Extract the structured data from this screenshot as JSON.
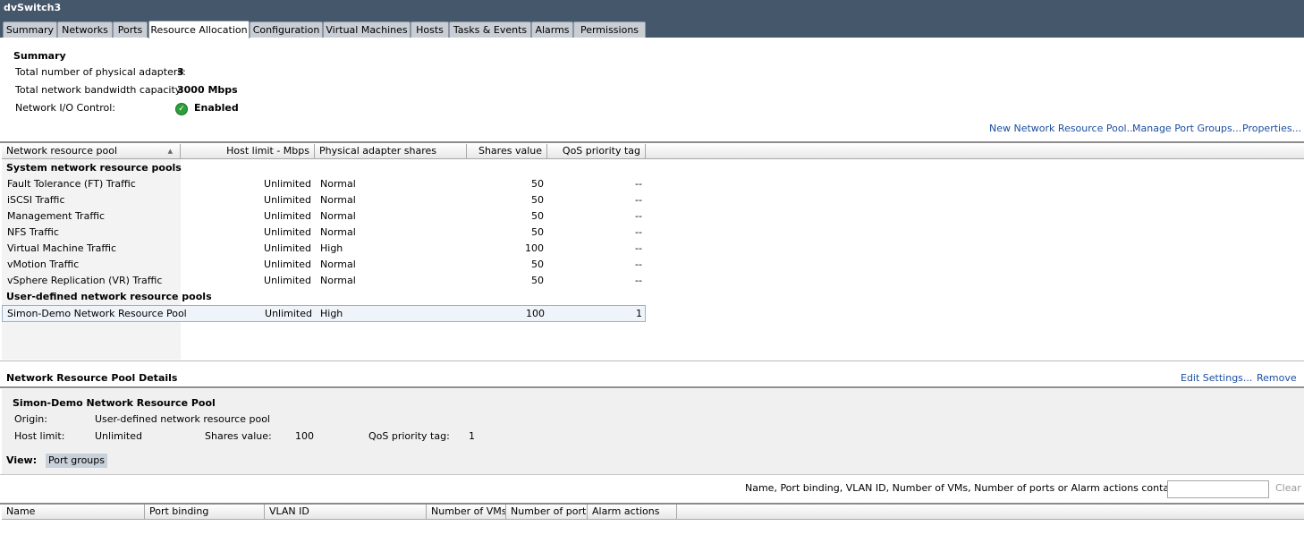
{
  "window": {
    "title": "dvSwitch3"
  },
  "tabs": [
    {
      "label": "Summary"
    },
    {
      "label": "Networks"
    },
    {
      "label": "Ports"
    },
    {
      "label": "Resource Allocation"
    },
    {
      "label": "Configuration"
    },
    {
      "label": "Virtual Machines"
    },
    {
      "label": "Hosts"
    },
    {
      "label": "Tasks & Events"
    },
    {
      "label": "Alarms"
    },
    {
      "label": "Permissions"
    }
  ],
  "active_tab": "Resource Allocation",
  "summary": {
    "heading": "Summary",
    "adapters_label": "Total number of physical adapters:",
    "adapters_value": "3",
    "bandwidth_label": "Total network bandwidth capacity:",
    "bandwidth_value": "3000 Mbps",
    "nioc_label": "Network I/O Control:",
    "nioc_value": "Enabled",
    "nioc_icon": "check-circle-icon",
    "nioc_color": "#2e9e3a"
  },
  "actions": {
    "new_pool": "New Network Resource Pool...",
    "manage_port_groups": "Manage Port Groups...",
    "properties": "Properties..."
  },
  "pools_table": {
    "columns": [
      "Network resource pool",
      "Host limit - Mbps",
      "Physical adapter shares",
      "Shares value",
      "QoS priority tag"
    ],
    "sort_icon": "sort-ascending-icon",
    "system_group": "System network resource pools",
    "system_rows": [
      {
        "name": "Fault Tolerance (FT) Traffic",
        "limit": "Unlimited",
        "shares": "Normal",
        "value": "50",
        "qos": "--"
      },
      {
        "name": "iSCSI Traffic",
        "limit": "Unlimited",
        "shares": "Normal",
        "value": "50",
        "qos": "--"
      },
      {
        "name": "Management Traffic",
        "limit": "Unlimited",
        "shares": "Normal",
        "value": "50",
        "qos": "--"
      },
      {
        "name": "NFS Traffic",
        "limit": "Unlimited",
        "shares": "Normal",
        "value": "50",
        "qos": "--"
      },
      {
        "name": "Virtual Machine Traffic",
        "limit": "Unlimited",
        "shares": "High",
        "value": "100",
        "qos": "--"
      },
      {
        "name": "vMotion Traffic",
        "limit": "Unlimited",
        "shares": "Normal",
        "value": "50",
        "qos": "--"
      },
      {
        "name": "vSphere Replication (VR) Traffic",
        "limit": "Unlimited",
        "shares": "Normal",
        "value": "50",
        "qos": "--"
      }
    ],
    "user_group": "User-defined network resource pools",
    "user_rows": [
      {
        "name": "Simon-Demo Network Resource Pool",
        "limit": "Unlimited",
        "shares": "High",
        "value": "100",
        "qos": "1"
      }
    ]
  },
  "details": {
    "heading": "Network Resource Pool Details",
    "edit_settings": "Edit Settings...",
    "remove": "Remove",
    "pool_name": "Simon-Demo Network Resource Pool",
    "origin_label": "Origin:",
    "origin_value": "User-defined network resource pool",
    "host_limit_label": "Host limit:",
    "host_limit_value": "Unlimited",
    "shares_label": "Shares value:",
    "shares_value": "100",
    "qos_label": "QoS priority tag:",
    "qos_value": "1",
    "view_label": "View:",
    "view_value": "Port groups"
  },
  "filter": {
    "label": "Name, Port binding, VLAN ID, Number of VMs, Number of ports or Alarm actions contains:",
    "dropdown_icon": "dropdown-arrow-icon",
    "value": "",
    "clear": "Clear"
  },
  "portgroups_table": {
    "columns": [
      "Name",
      "Port binding",
      "VLAN ID",
      "Number of VMs",
      "Number of ports",
      "Alarm actions"
    ]
  }
}
